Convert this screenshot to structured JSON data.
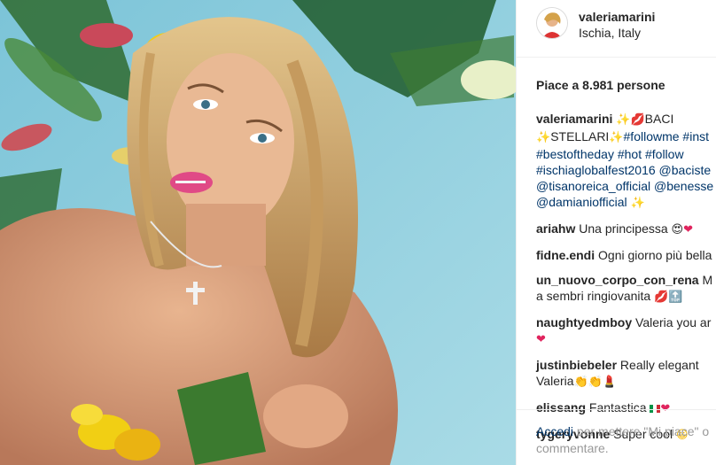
{
  "post": {
    "username": "valeriamarini",
    "location": "Ischia, Italy",
    "likes": "Piace a 8.981 persone"
  },
  "caption": {
    "user": "valeriamarini",
    "line1_text": "BACI",
    "line2_text": "STELLARI",
    "line2_tag": "#followme #inst",
    "line3": "#bestoftheday #hot #follow",
    "line4": "#ischiaglobalfest2016 @baciste",
    "line5": "@tisanoreica_official @benesse",
    "line6": "@damianiofficial"
  },
  "comments": [
    {
      "user": "ariahw",
      "text": "Una principessa"
    },
    {
      "user": "fidne.endi",
      "text": "Ogni giorno più bella"
    },
    {
      "user": "un_nuovo_corpo_con_rena",
      "text": "M",
      "text2": "a sembri ringiovanita"
    },
    {
      "user": "naughtyedmboy",
      "text": "Valeria you ar"
    },
    {
      "user": "justinbiebeler",
      "text": "Really elegant",
      "text2": "Valeria"
    },
    {
      "user": "elissang",
      "text": "Fantastica"
    },
    {
      "user": "tygeryvonne",
      "text": "Super cool"
    }
  ],
  "footer": {
    "login_link": "Accedi",
    "rest_line1": " per mettere \"Mi piace\" o",
    "line2": "commentare."
  },
  "icons": {
    "sparkles": "sparkles-icon",
    "kiss": "kiss-mark-icon",
    "heart": "red-heart-icon",
    "heart_eyes": "heart-eyes-emoji-icon",
    "grin": "grinning-emoji-icon",
    "clap": "clapping-hands-icon",
    "lipstick": "lipstick-icon",
    "top": "top-arrow-icon",
    "flag": "italy-flag-icon"
  },
  "colors": {
    "link": "#003569",
    "muted": "#999999",
    "text": "#262626",
    "water": "#8ac9dc"
  }
}
